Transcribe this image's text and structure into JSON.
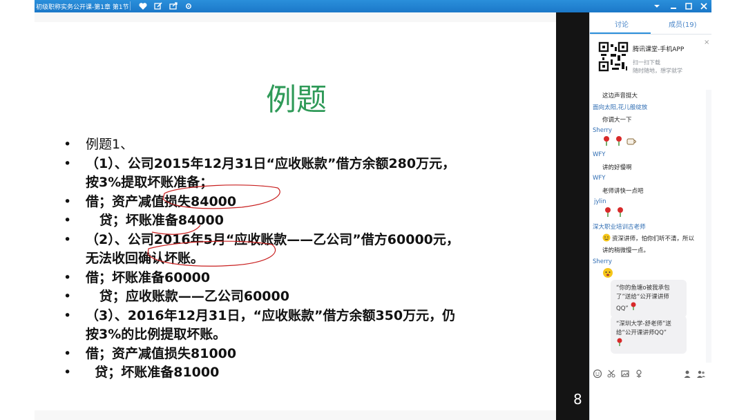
{
  "window": {
    "title": "初级职称实务公开课-第1章 第1节"
  },
  "slide": {
    "title": "例题",
    "lines": [
      {
        "text": "例题1、"
      },
      {
        "text": "（1）、公司2015年12月31日“应收账款”借方余额280万元，",
        "cont": "按3%提取坏账准备；"
      },
      {
        "text": "借；资产减值损失84000"
      },
      {
        "text": "   贷；坏账准备84000"
      },
      {
        "text": "（2）、公司2016年5月“应收账款——乙公司”借方60000元，",
        "cont": "无法收回确认坏账。"
      },
      {
        "text": "借；坏账准备60000"
      },
      {
        "text": "   贷；应收账款——乙公司60000"
      },
      {
        "text": "（3）、2016年12月31日，“应收账款”借方余额350万元，仍",
        "cont": "按3%的比例提取坏账。"
      },
      {
        "text": "借；资产减值损失81000"
      },
      {
        "text": "  贷；坏账准备81000"
      }
    ]
  },
  "side_panel": {
    "tabs": [
      "讨论",
      "成员(19)"
    ],
    "promo": {
      "title": "腾讯课堂-手机APP",
      "line1": "扫一扫下载",
      "line2": "随时随地，想学就学",
      "close": "×"
    },
    "chat": [
      {
        "nick": "",
        "text": "这边声音挺大"
      },
      {
        "nick": "面向太阳,花儿般绽放",
        "text": "你调大一下"
      },
      {
        "nick": "Sherry",
        "text": ""
      },
      {
        "nick": "WFY",
        "text": "讲的好慢啊"
      },
      {
        "nick": "WFY",
        "text": "老师讲快一点吧"
      },
      {
        "nick": "jylin",
        "text": ""
      },
      {
        "nick": "深大职业培训古老师",
        "text": "资深讲师，怕你们听不清，所以",
        "cont": "讲的稍微慢一点。"
      },
      {
        "nick": "Sherry",
        "text": ""
      }
    ],
    "gifts": [
      {
        "text": "“你的鱼塘o被我承包了”送给“公开课讲师QQ”"
      },
      {
        "text": "“深圳大学-舒老师”送给“公开课讲师QQ”"
      }
    ]
  },
  "overlay": {
    "bottom_glyph": "8"
  },
  "colors": {
    "title_bar": "#1b78c8",
    "slide_title": "#2f9a58",
    "ink_annotation": "#c81e1e",
    "nick": "#2f6db3"
  }
}
